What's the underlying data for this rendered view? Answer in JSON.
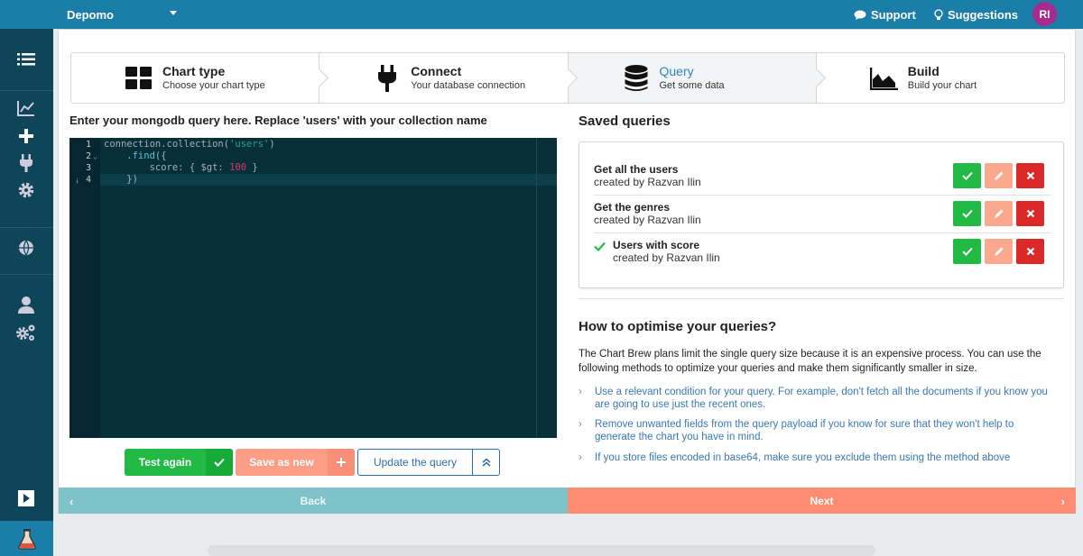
{
  "topbar": {
    "project": "Depomo",
    "support": "Support",
    "suggestions": "Suggestions",
    "avatar_initials": "RI"
  },
  "sidebar": {
    "icons": [
      "list-icon",
      "chart-icon",
      "plus-icon",
      "plug-icon",
      "gear-icon",
      "globe-icon",
      "user-icon",
      "gears-icon",
      "play-icon",
      "flask-icon"
    ]
  },
  "steps": [
    {
      "title": "Chart type",
      "description": "Choose your chart type",
      "icon": "grid-icon"
    },
    {
      "title": "Connect",
      "description": "Your database connection",
      "icon": "plug-icon"
    },
    {
      "title": "Query",
      "description": "Get some data",
      "icon": "database-icon",
      "active": true
    },
    {
      "title": "Build",
      "description": "Build your chart",
      "icon": "area-chart-icon"
    }
  ],
  "editor": {
    "title": "Enter your mongodb query here. Replace 'users' with your collection name",
    "line_numbers": [
      "1",
      "2",
      "3",
      "4"
    ],
    "lines": [
      "connection.collection('users')",
      "    .find({",
      "        score: { $gt: 100 }",
      "    })"
    ]
  },
  "buttons": {
    "test": "Test again",
    "save_new": "Save as new",
    "update": "Update the query"
  },
  "saved": {
    "title": "Saved queries",
    "queries": [
      {
        "name": "Get all the users",
        "created_by": "created by Razvan Ilin",
        "selected": false
      },
      {
        "name": "Get the genres",
        "created_by": "created by Razvan Ilin",
        "selected": false
      },
      {
        "name": "Users with score",
        "created_by": "created by Razvan Ilin",
        "selected": true
      }
    ]
  },
  "optimise": {
    "title": "How to optimise your queries?",
    "description": "The Chart Brew plans limit the single query size because it is an expensive process. You can use the following methods to optimize your queries and make them significantly smaller in size.",
    "tips": [
      "Use a relevant condition for your query. For example, don't fetch all the documents if you know you are going to use just the recent ones.",
      "Remove unwanted fields from the query payload if you know for sure that they won't help to generate the chart you have in mind.",
      "If you store files encoded in base64, make sure you exclude them using the method above"
    ]
  },
  "nav": {
    "back": "Back",
    "next": "Next"
  },
  "colors": {
    "topbar": "#1a7ea8",
    "sidebar": "#0e4559",
    "success": "#21ba45",
    "salmon": "#fc8d72",
    "danger": "#db2828",
    "link": "#3a78b4"
  }
}
